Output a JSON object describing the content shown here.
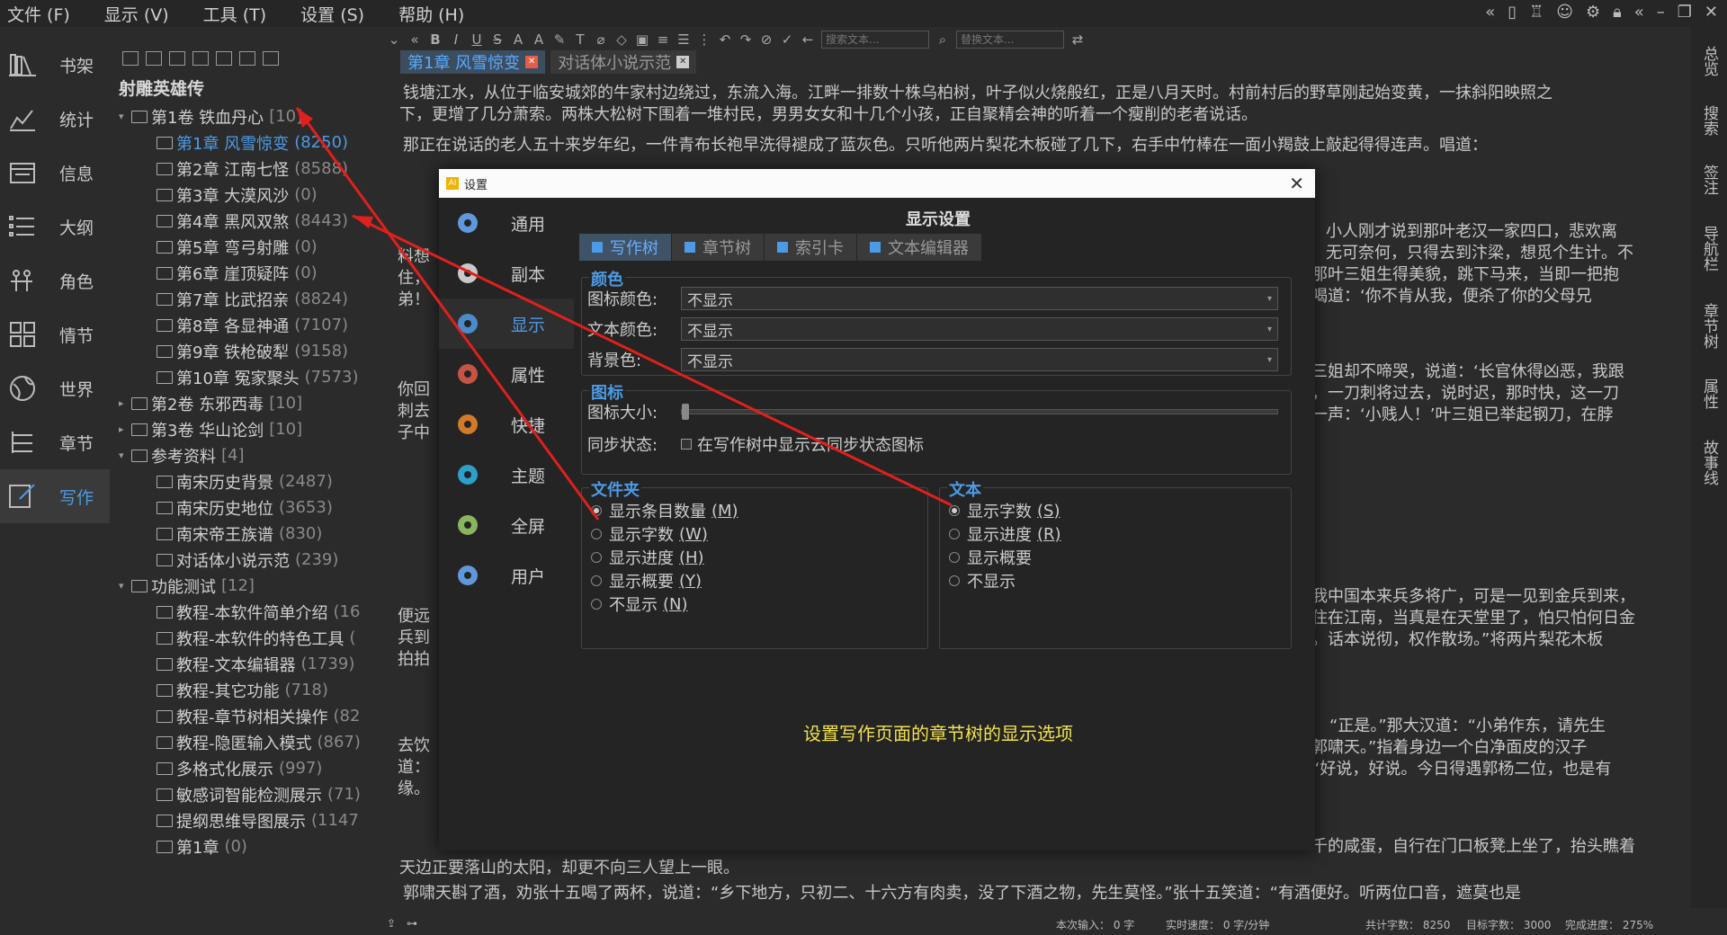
{
  "menubar": {
    "items": [
      "文件 (F)",
      "显示 (V)",
      "工具 (T)",
      "设置 (S)",
      "帮助 (H)"
    ]
  },
  "left_nav": {
    "items": [
      {
        "label": "书架",
        "icon": "bookshelf-icon"
      },
      {
        "label": "统计",
        "icon": "chart-icon"
      },
      {
        "label": "信息",
        "icon": "calendar-icon"
      },
      {
        "label": "大纲",
        "icon": "outline-icon"
      },
      {
        "label": "角色",
        "icon": "people-icon"
      },
      {
        "label": "情节",
        "icon": "grid-icon"
      },
      {
        "label": "世界",
        "icon": "globe-icon"
      },
      {
        "label": "章节",
        "icon": "chapters-icon"
      },
      {
        "label": "写作",
        "icon": "pen-icon"
      }
    ],
    "active_index": 8
  },
  "tree": {
    "book_title": "射雕英雄传",
    "nodes": [
      {
        "indent": 0,
        "expand": "▾",
        "type": "folder",
        "label": "第1卷 铁血丹心",
        "count": "[10]"
      },
      {
        "indent": 1,
        "expand": "",
        "type": "doc",
        "label": "第1章 风雪惊变",
        "count": "(8250)",
        "selected": true
      },
      {
        "indent": 1,
        "expand": "",
        "type": "doc",
        "label": "第2章 江南七怪",
        "count": "(8588)"
      },
      {
        "indent": 1,
        "expand": "",
        "type": "doc",
        "label": "第3章 大漠风沙",
        "count": "(0)"
      },
      {
        "indent": 1,
        "expand": "",
        "type": "doc",
        "label": "第4章 黑风双煞",
        "count": "(8443)"
      },
      {
        "indent": 1,
        "expand": "",
        "type": "doc",
        "label": "第5章 弯弓射雕",
        "count": "(0)"
      },
      {
        "indent": 1,
        "expand": "",
        "type": "doc",
        "label": "第6章 崖顶疑阵",
        "count": "(0)"
      },
      {
        "indent": 1,
        "expand": "",
        "type": "doc",
        "label": "第7章 比武招亲",
        "count": "(8824)"
      },
      {
        "indent": 1,
        "expand": "",
        "type": "doc",
        "label": "第8章 各显神通",
        "count": "(7107)"
      },
      {
        "indent": 1,
        "expand": "",
        "type": "doc",
        "label": "第9章 铁枪破犁",
        "count": "(9158)"
      },
      {
        "indent": 1,
        "expand": "",
        "type": "doc",
        "label": "第10章 冤家聚头",
        "count": "(7573)"
      },
      {
        "indent": 0,
        "expand": "▸",
        "type": "folder",
        "label": "第2卷 东邪西毒",
        "count": "[10]"
      },
      {
        "indent": 0,
        "expand": "▸",
        "type": "folder",
        "label": "第3卷 华山论剑",
        "count": "[10]"
      },
      {
        "indent": 0,
        "expand": "▾",
        "type": "folder",
        "label": "参考资料",
        "count": "[4]"
      },
      {
        "indent": 1,
        "expand": "",
        "type": "doc",
        "label": "南宋历史背景",
        "count": "(2487)"
      },
      {
        "indent": 1,
        "expand": "",
        "type": "doc",
        "label": "南宋历史地位",
        "count": "(3653)"
      },
      {
        "indent": 1,
        "expand": "",
        "type": "doc",
        "label": "南宋帝王族谱",
        "count": "(830)"
      },
      {
        "indent": 1,
        "expand": "",
        "type": "doc",
        "label": "对话体小说示范",
        "count": "(239)"
      },
      {
        "indent": 0,
        "expand": "▾",
        "type": "folder",
        "label": "功能测试",
        "count": "[12]"
      },
      {
        "indent": 1,
        "expand": "",
        "type": "doc",
        "label": "教程-本软件简单介绍",
        "count": "(16"
      },
      {
        "indent": 1,
        "expand": "",
        "type": "doc",
        "label": "教程-本软件的特色工具",
        "count": "("
      },
      {
        "indent": 1,
        "expand": "",
        "type": "doc",
        "label": "教程-文本编辑器",
        "count": "(1739)"
      },
      {
        "indent": 1,
        "expand": "",
        "type": "doc",
        "label": "教程-其它功能",
        "count": "(718)"
      },
      {
        "indent": 1,
        "expand": "",
        "type": "doc",
        "label": "教程-章节树相关操作",
        "count": "(82"
      },
      {
        "indent": 1,
        "expand": "",
        "type": "doc",
        "label": "教程-隐匿输入模式",
        "count": "(867)"
      },
      {
        "indent": 1,
        "expand": "",
        "type": "doc",
        "label": "多格式化展示",
        "count": "(997)"
      },
      {
        "indent": 1,
        "expand": "",
        "type": "doc",
        "label": "敏感词智能检测展示",
        "count": "(71)"
      },
      {
        "indent": 1,
        "expand": "",
        "type": "doc",
        "label": "提纲思维导图展示",
        "count": "(1147"
      },
      {
        "indent": 1,
        "expand": "",
        "type": "doc",
        "label": "第1章",
        "count": "(0)"
      }
    ]
  },
  "toolbar": {
    "search_placeholder": "搜索文本...",
    "replace_placeholder": "替换文本..."
  },
  "tabs": [
    {
      "label": "第1章 风雪惊变",
      "active": true
    },
    {
      "label": "对话体小说示范",
      "active": false
    }
  ],
  "editor": {
    "paragraphs": [
      "钱塘江水，从位于临安城郊的牛家村边绕过，东流入海。江畔一排数十株乌柏树，叶子似火烧般红，正是八月天时。村前村后的野草刚起始变黄，一抹斜阳映照之",
      "下，更增了几分萧索。两株大松树下围着一堆村民，男男女女和十几个小孩，正自聚精会神的听着一个瘦削的老者说话。",
      "那正在说话的老人五十来岁年纪，一件青布长袍早洗得褪成了蓝灰色。只听他两片梨花木板碰了几下，右手中竹棒在一面小羯鼓上敲起得得连声。唱道：",
      "小人刚才说到那叶老汉一家四口，悲欢离",
      "无可奈何，只得去到汴梁，想觅个生计。不",
      "那叶三姐生得美貌，跳下马来，当即一把抱",
      "喝道：‘你不肯从我，便杀了你的父母兄",
      "三姐却不啼哭，说道：‘长官休得凶恶，我跟",
      "，一刀刺将过去，说时迟，那时快，这一刀",
      "一声：‘小贱人！’叶三姐已举起钢刀，在脖",
      "我中国本来兵多将广，可是一见到金兵到来，",
      "住在江南，当真是在天堂里了，怕只怕何日金",
      "。话本说彻，权作散场。”将两片梨花木板",
      "“正是。”那大汉道：“小弟作东，请先生",
      "郭啸天。”指着身边一个白净面皮的汉子",
      "“好说，好说。今日得遇郭杨二位，也是有",
      "千的咸蛋，自行在门口板凳上坐了，抬头瞧着",
      "天边正要落山的太阳，却更不向三人望上一眼。",
      "郭啸天斟了酒，劝张十五喝了两杯，说道：“乡下地方，只初二、十六方有肉卖，没了下酒之物，先生莫怪。”张十五笑道：“有酒便好。听两位口音，遮莫也是"
    ],
    "left_fragments": [
      "料想",
      "住，",
      "弟！",
      "你回",
      "刺去",
      "子中",
      "便远",
      "兵到",
      "拍拍",
      "去饮",
      "道：",
      "缘。"
    ]
  },
  "right_bar": {
    "items": [
      "总览",
      "搜索",
      "签注",
      "导航栏",
      "章节树",
      "属性",
      "故事线"
    ]
  },
  "status": {
    "session_input": "本次输入： 0  字",
    "speed": "实时速度： 0  字/分钟",
    "total": "共计字数： 8250",
    "target": "目标字数： 3000",
    "progress": "完成进度： 275%"
  },
  "dialog": {
    "title": "设置",
    "app_icon_text": "AI",
    "nav": [
      {
        "label": "通用",
        "icon": "gear-icon"
      },
      {
        "label": "副本",
        "icon": "clock-icon"
      },
      {
        "label": "显示",
        "icon": "sliders-icon"
      },
      {
        "label": "属性",
        "icon": "palette-icon"
      },
      {
        "label": "快捷",
        "icon": "keyboard-icon"
      },
      {
        "label": "主题",
        "icon": "shirt-icon"
      },
      {
        "label": "全屏",
        "icon": "fullscreen-icon"
      },
      {
        "label": "用户",
        "icon": "user-settings-icon"
      }
    ],
    "active_nav": 2,
    "heading": "显示设置",
    "tabs": [
      "写作树",
      "章节树",
      "索引卡",
      "文本编辑器"
    ],
    "active_tab": 0,
    "color_group": {
      "title": "颜色",
      "rows": [
        {
          "label": "图标颜色:",
          "value": "不显示"
        },
        {
          "label": "文本颜色:",
          "value": "不显示"
        },
        {
          "label": "背景色:",
          "value": "不显示"
        }
      ]
    },
    "icon_group": {
      "title": "图标",
      "size_label": "图标大小:",
      "size_value": 0,
      "sync_label": "同步状态:",
      "sync_checkbox": "在写作树中显示云同步状态图标"
    },
    "folder_group": {
      "title": "文件夹",
      "options": [
        {
          "label": "显示条目数量",
          "key": "(M)",
          "checked": true
        },
        {
          "label": "显示字数",
          "key": "(W)",
          "checked": false
        },
        {
          "label": "显示进度",
          "key": "(H)",
          "checked": false
        },
        {
          "label": "显示概要",
          "key": "(Y)",
          "checked": false
        },
        {
          "label": "不显示",
          "key": "(N)",
          "checked": false
        }
      ]
    },
    "text_group": {
      "title": "文本",
      "options": [
        {
          "label": "显示字数",
          "key": "(S)",
          "checked": true
        },
        {
          "label": "显示进度",
          "key": "(R)",
          "checked": false
        },
        {
          "label": "显示概要",
          "key": "",
          "checked": false
        },
        {
          "label": "不显示",
          "key": "",
          "checked": false
        }
      ]
    },
    "hint": "设置写作页面的章节树的显示选项"
  },
  "colors": {
    "accent": "#4d9be6",
    "hint": "#f2e24b",
    "arrow": "#e0201c",
    "tab_close": "#e35d4a"
  }
}
